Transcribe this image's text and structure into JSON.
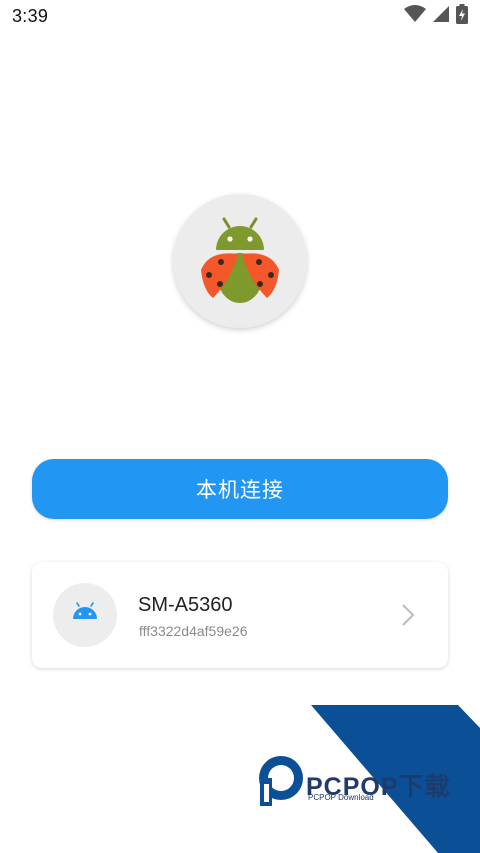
{
  "status_bar": {
    "time": "3:39",
    "icons": [
      "wifi-icon",
      "signal-icon",
      "battery-charging-icon"
    ]
  },
  "app_logo": {
    "icon": "ladybug-android-icon"
  },
  "connect_button": {
    "label": "本机连接",
    "color": "#2196f3"
  },
  "device": {
    "icon": "android-icon",
    "name": "SM-A5360",
    "serial": "fff3322d4af59e26"
  },
  "watermark": {
    "title": "PCPOP下载",
    "subtitle": "PCPOP Download",
    "colors": {
      "navy": "#0b4f96",
      "text": "#1f3a6b"
    }
  }
}
